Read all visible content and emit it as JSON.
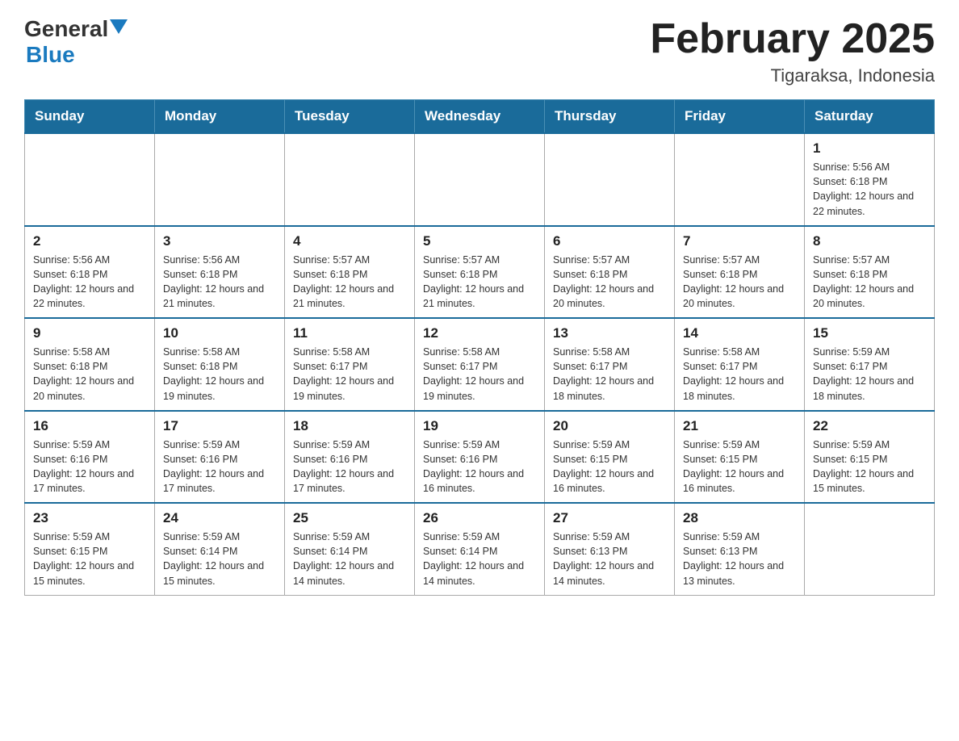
{
  "header": {
    "logo_general": "General",
    "logo_blue": "Blue",
    "title": "February 2025",
    "location": "Tigaraksa, Indonesia"
  },
  "weekdays": [
    "Sunday",
    "Monday",
    "Tuesday",
    "Wednesday",
    "Thursday",
    "Friday",
    "Saturday"
  ],
  "weeks": [
    [
      {
        "day": "",
        "info": ""
      },
      {
        "day": "",
        "info": ""
      },
      {
        "day": "",
        "info": ""
      },
      {
        "day": "",
        "info": ""
      },
      {
        "day": "",
        "info": ""
      },
      {
        "day": "",
        "info": ""
      },
      {
        "day": "1",
        "info": "Sunrise: 5:56 AM\nSunset: 6:18 PM\nDaylight: 12 hours\nand 22 minutes."
      }
    ],
    [
      {
        "day": "2",
        "info": "Sunrise: 5:56 AM\nSunset: 6:18 PM\nDaylight: 12 hours\nand 22 minutes."
      },
      {
        "day": "3",
        "info": "Sunrise: 5:56 AM\nSunset: 6:18 PM\nDaylight: 12 hours\nand 21 minutes."
      },
      {
        "day": "4",
        "info": "Sunrise: 5:57 AM\nSunset: 6:18 PM\nDaylight: 12 hours\nand 21 minutes."
      },
      {
        "day": "5",
        "info": "Sunrise: 5:57 AM\nSunset: 6:18 PM\nDaylight: 12 hours\nand 21 minutes."
      },
      {
        "day": "6",
        "info": "Sunrise: 5:57 AM\nSunset: 6:18 PM\nDaylight: 12 hours\nand 20 minutes."
      },
      {
        "day": "7",
        "info": "Sunrise: 5:57 AM\nSunset: 6:18 PM\nDaylight: 12 hours\nand 20 minutes."
      },
      {
        "day": "8",
        "info": "Sunrise: 5:57 AM\nSunset: 6:18 PM\nDaylight: 12 hours\nand 20 minutes."
      }
    ],
    [
      {
        "day": "9",
        "info": "Sunrise: 5:58 AM\nSunset: 6:18 PM\nDaylight: 12 hours\nand 20 minutes."
      },
      {
        "day": "10",
        "info": "Sunrise: 5:58 AM\nSunset: 6:18 PM\nDaylight: 12 hours\nand 19 minutes."
      },
      {
        "day": "11",
        "info": "Sunrise: 5:58 AM\nSunset: 6:17 PM\nDaylight: 12 hours\nand 19 minutes."
      },
      {
        "day": "12",
        "info": "Sunrise: 5:58 AM\nSunset: 6:17 PM\nDaylight: 12 hours\nand 19 minutes."
      },
      {
        "day": "13",
        "info": "Sunrise: 5:58 AM\nSunset: 6:17 PM\nDaylight: 12 hours\nand 18 minutes."
      },
      {
        "day": "14",
        "info": "Sunrise: 5:58 AM\nSunset: 6:17 PM\nDaylight: 12 hours\nand 18 minutes."
      },
      {
        "day": "15",
        "info": "Sunrise: 5:59 AM\nSunset: 6:17 PM\nDaylight: 12 hours\nand 18 minutes."
      }
    ],
    [
      {
        "day": "16",
        "info": "Sunrise: 5:59 AM\nSunset: 6:16 PM\nDaylight: 12 hours\nand 17 minutes."
      },
      {
        "day": "17",
        "info": "Sunrise: 5:59 AM\nSunset: 6:16 PM\nDaylight: 12 hours\nand 17 minutes."
      },
      {
        "day": "18",
        "info": "Sunrise: 5:59 AM\nSunset: 6:16 PM\nDaylight: 12 hours\nand 17 minutes."
      },
      {
        "day": "19",
        "info": "Sunrise: 5:59 AM\nSunset: 6:16 PM\nDaylight: 12 hours\nand 16 minutes."
      },
      {
        "day": "20",
        "info": "Sunrise: 5:59 AM\nSunset: 6:15 PM\nDaylight: 12 hours\nand 16 minutes."
      },
      {
        "day": "21",
        "info": "Sunrise: 5:59 AM\nSunset: 6:15 PM\nDaylight: 12 hours\nand 16 minutes."
      },
      {
        "day": "22",
        "info": "Sunrise: 5:59 AM\nSunset: 6:15 PM\nDaylight: 12 hours\nand 15 minutes."
      }
    ],
    [
      {
        "day": "23",
        "info": "Sunrise: 5:59 AM\nSunset: 6:15 PM\nDaylight: 12 hours\nand 15 minutes."
      },
      {
        "day": "24",
        "info": "Sunrise: 5:59 AM\nSunset: 6:14 PM\nDaylight: 12 hours\nand 15 minutes."
      },
      {
        "day": "25",
        "info": "Sunrise: 5:59 AM\nSunset: 6:14 PM\nDaylight: 12 hours\nand 14 minutes."
      },
      {
        "day": "26",
        "info": "Sunrise: 5:59 AM\nSunset: 6:14 PM\nDaylight: 12 hours\nand 14 minutes."
      },
      {
        "day": "27",
        "info": "Sunrise: 5:59 AM\nSunset: 6:13 PM\nDaylight: 12 hours\nand 14 minutes."
      },
      {
        "day": "28",
        "info": "Sunrise: 5:59 AM\nSunset: 6:13 PM\nDaylight: 12 hours\nand 13 minutes."
      },
      {
        "day": "",
        "info": ""
      }
    ]
  ]
}
